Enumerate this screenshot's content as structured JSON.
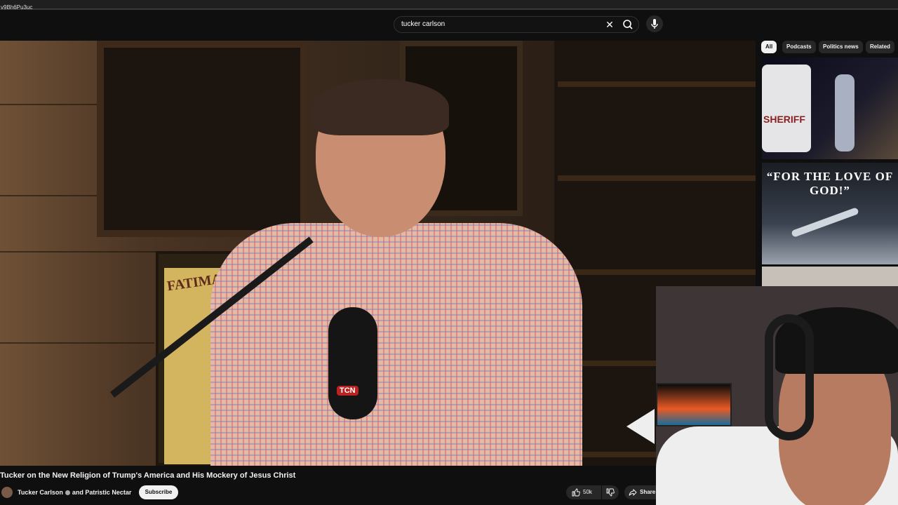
{
  "browser": {
    "url_fragment": "v9Bh6Pu3uc"
  },
  "search": {
    "query": "tucker carlson"
  },
  "video": {
    "title": "Tucker on the New Religion of Trump's America and His Mockery of Jesus Christ",
    "channel": "Tucker Carlson",
    "collab": "and Patristic Nectar",
    "subscribe_label": "Subscribe",
    "likes": "50k",
    "share_label": "Share",
    "poster_text": "FATIMA",
    "mic_logo": "TCN"
  },
  "chips": [
    {
      "label": "All",
      "active": true
    },
    {
      "label": "Podcasts",
      "active": false
    },
    {
      "label": "Politics news",
      "active": false
    },
    {
      "label": "Related",
      "active": false
    }
  ],
  "thumbnails": {
    "t1_text": "SHERIFF",
    "t2_text": "“FOR THE LOVE OF GOD!”"
  },
  "icons": [
    "clear-icon",
    "search-icon",
    "mic-icon",
    "thumbs-up-icon",
    "thumbs-down-icon",
    "share-icon",
    "verified-icon"
  ],
  "colors": {
    "background": "#0f0f0f",
    "chip_active": "#f1f1f1",
    "button_bg": "#272727"
  }
}
